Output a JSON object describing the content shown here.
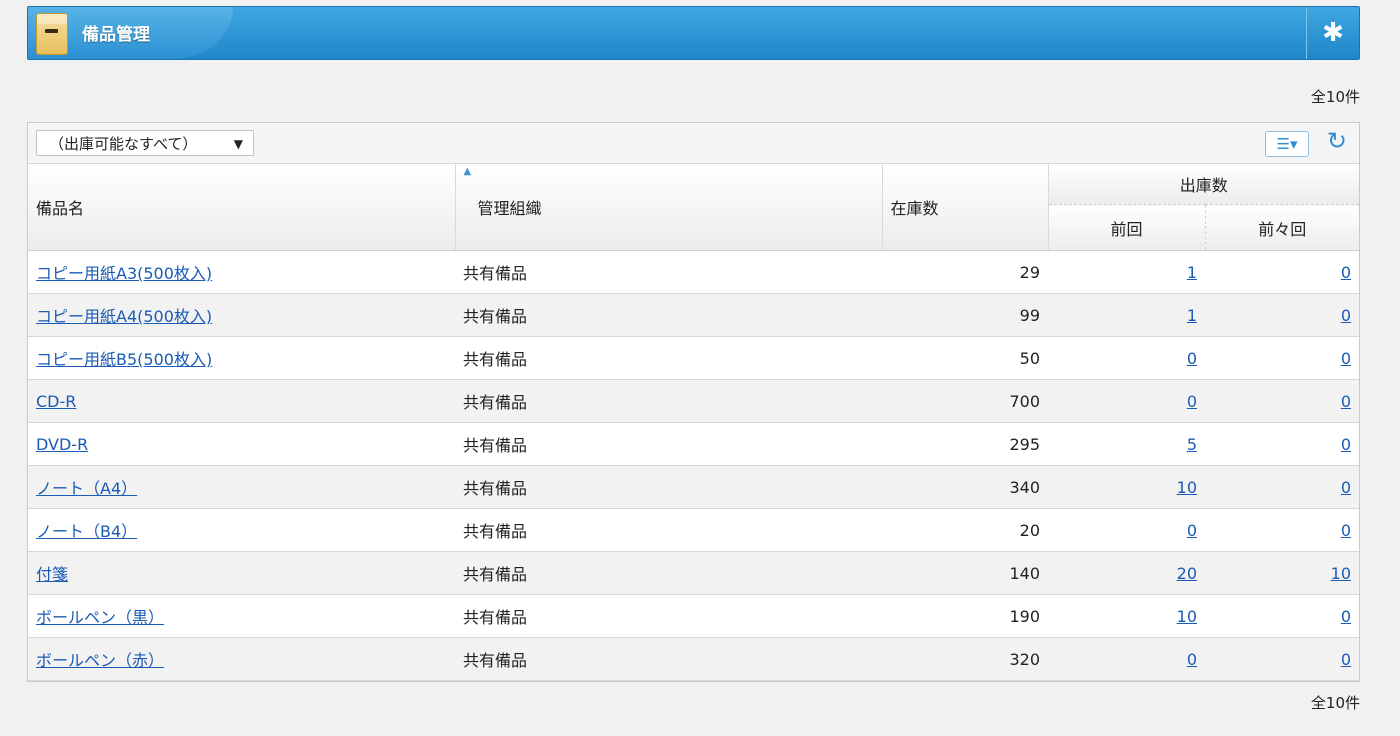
{
  "header": {
    "title": "備品管理"
  },
  "counts": {
    "top": "全10件",
    "bottom": "全10件"
  },
  "toolbar": {
    "filter_value": "（出庫可能なすべて）"
  },
  "table": {
    "columns": {
      "name": "備品名",
      "org": "管理組織",
      "stock": "在庫数",
      "shipped": "出庫数",
      "prev": "前回",
      "prev2": "前々回"
    },
    "rows": [
      {
        "name": "コピー用紙A3(500枚入)",
        "org": "共有備品",
        "stock": "29",
        "prev": "1",
        "prev2": "0"
      },
      {
        "name": "コピー用紙A4(500枚入)",
        "org": "共有備品",
        "stock": "99",
        "prev": "1",
        "prev2": "0"
      },
      {
        "name": "コピー用紙B5(500枚入)",
        "org": "共有備品",
        "stock": "50",
        "prev": "0",
        "prev2": "0"
      },
      {
        "name": "CD-R",
        "org": "共有備品",
        "stock": "700",
        "prev": "0",
        "prev2": "0"
      },
      {
        "name": "DVD-R",
        "org": "共有備品",
        "stock": "295",
        "prev": "5",
        "prev2": "0"
      },
      {
        "name": "ノート（A4）",
        "org": "共有備品",
        "stock": "340",
        "prev": "10",
        "prev2": "0"
      },
      {
        "name": "ノート（B4）",
        "org": "共有備品",
        "stock": "20",
        "prev": "0",
        "prev2": "0"
      },
      {
        "name": "付箋",
        "org": "共有備品",
        "stock": "140",
        "prev": "20",
        "prev2": "10"
      },
      {
        "name": "ボールペン（黒）",
        "org": "共有備品",
        "stock": "190",
        "prev": "10",
        "prev2": "0"
      },
      {
        "name": "ボールペン（赤）",
        "org": "共有備品",
        "stock": "320",
        "prev": "0",
        "prev2": "0"
      }
    ]
  }
}
